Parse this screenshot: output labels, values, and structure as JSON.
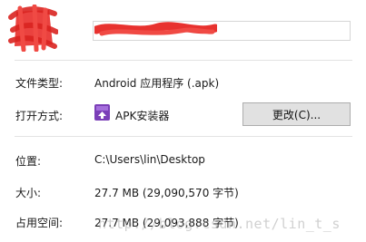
{
  "header": {
    "file_name_redacted": "",
    "file_name_field": ""
  },
  "details": {
    "file_type_label": "文件类型:",
    "file_type_value": "Android 应用程序 (.apk)",
    "open_with_label": "打开方式:",
    "open_with_app": "APK安装器",
    "change_button": "更改(C)...",
    "location_label": "位置:",
    "location_value": "C:\\Users\\lin\\Desktop",
    "size_label": "大小:",
    "size_value": "27.7 MB (29,090,570 字节)",
    "size_on_disk_label": "占用空间:",
    "size_on_disk_value": "27.7 MB (29,093,888 字节)"
  },
  "icons": {
    "file_icon": "redacted-file-icon",
    "app_icon": "apk-installer-icon"
  },
  "watermark": "http://blog.csdn.net/lin_t_s",
  "colors": {
    "redaction": "#e8322f",
    "app_icon_purple": "#7b3fb8",
    "button_bg": "#e1e1e1",
    "divider": "#e3e3e3"
  }
}
